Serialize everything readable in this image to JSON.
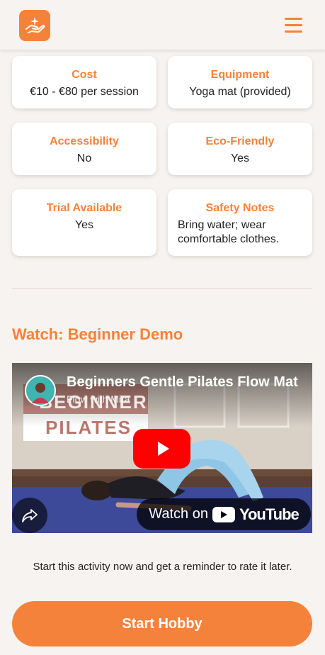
{
  "colors": {
    "accent": "#f5823a",
    "background": "#f7f3f0",
    "card": "#ffffff",
    "youtube_red": "#ff0000"
  },
  "header": {
    "logo_icon": "hand-sparkle-icon",
    "menu_icon": "hamburger-menu-icon"
  },
  "details": [
    {
      "label": "Cost",
      "value": "€10 - €80 per session"
    },
    {
      "label": "Equipment",
      "value": "Yoga mat (provided)"
    },
    {
      "label": "Accessibility",
      "value": "No"
    },
    {
      "label": "Eco-Friendly",
      "value": "Yes"
    },
    {
      "label": "Trial Available",
      "value": "Yes"
    },
    {
      "label": "Safety Notes",
      "value": "Bring water; wear comfortable clothes."
    }
  ],
  "video_section": {
    "title": "Watch: Beginner Demo",
    "video": {
      "title": "Beginners Gentle Pilates Flow Mat",
      "channel": "Flow with Mira",
      "thumbnail_text_top": "BEGINNER",
      "thumbnail_text_bottom": "PILATES",
      "watch_on": "Watch on",
      "platform": "YouTube",
      "play_icon": "play-icon",
      "share_icon": "share-icon"
    }
  },
  "footer": {
    "caption": "Start this activity now and get a reminder to rate it later.",
    "start_button": "Start Hobby"
  }
}
